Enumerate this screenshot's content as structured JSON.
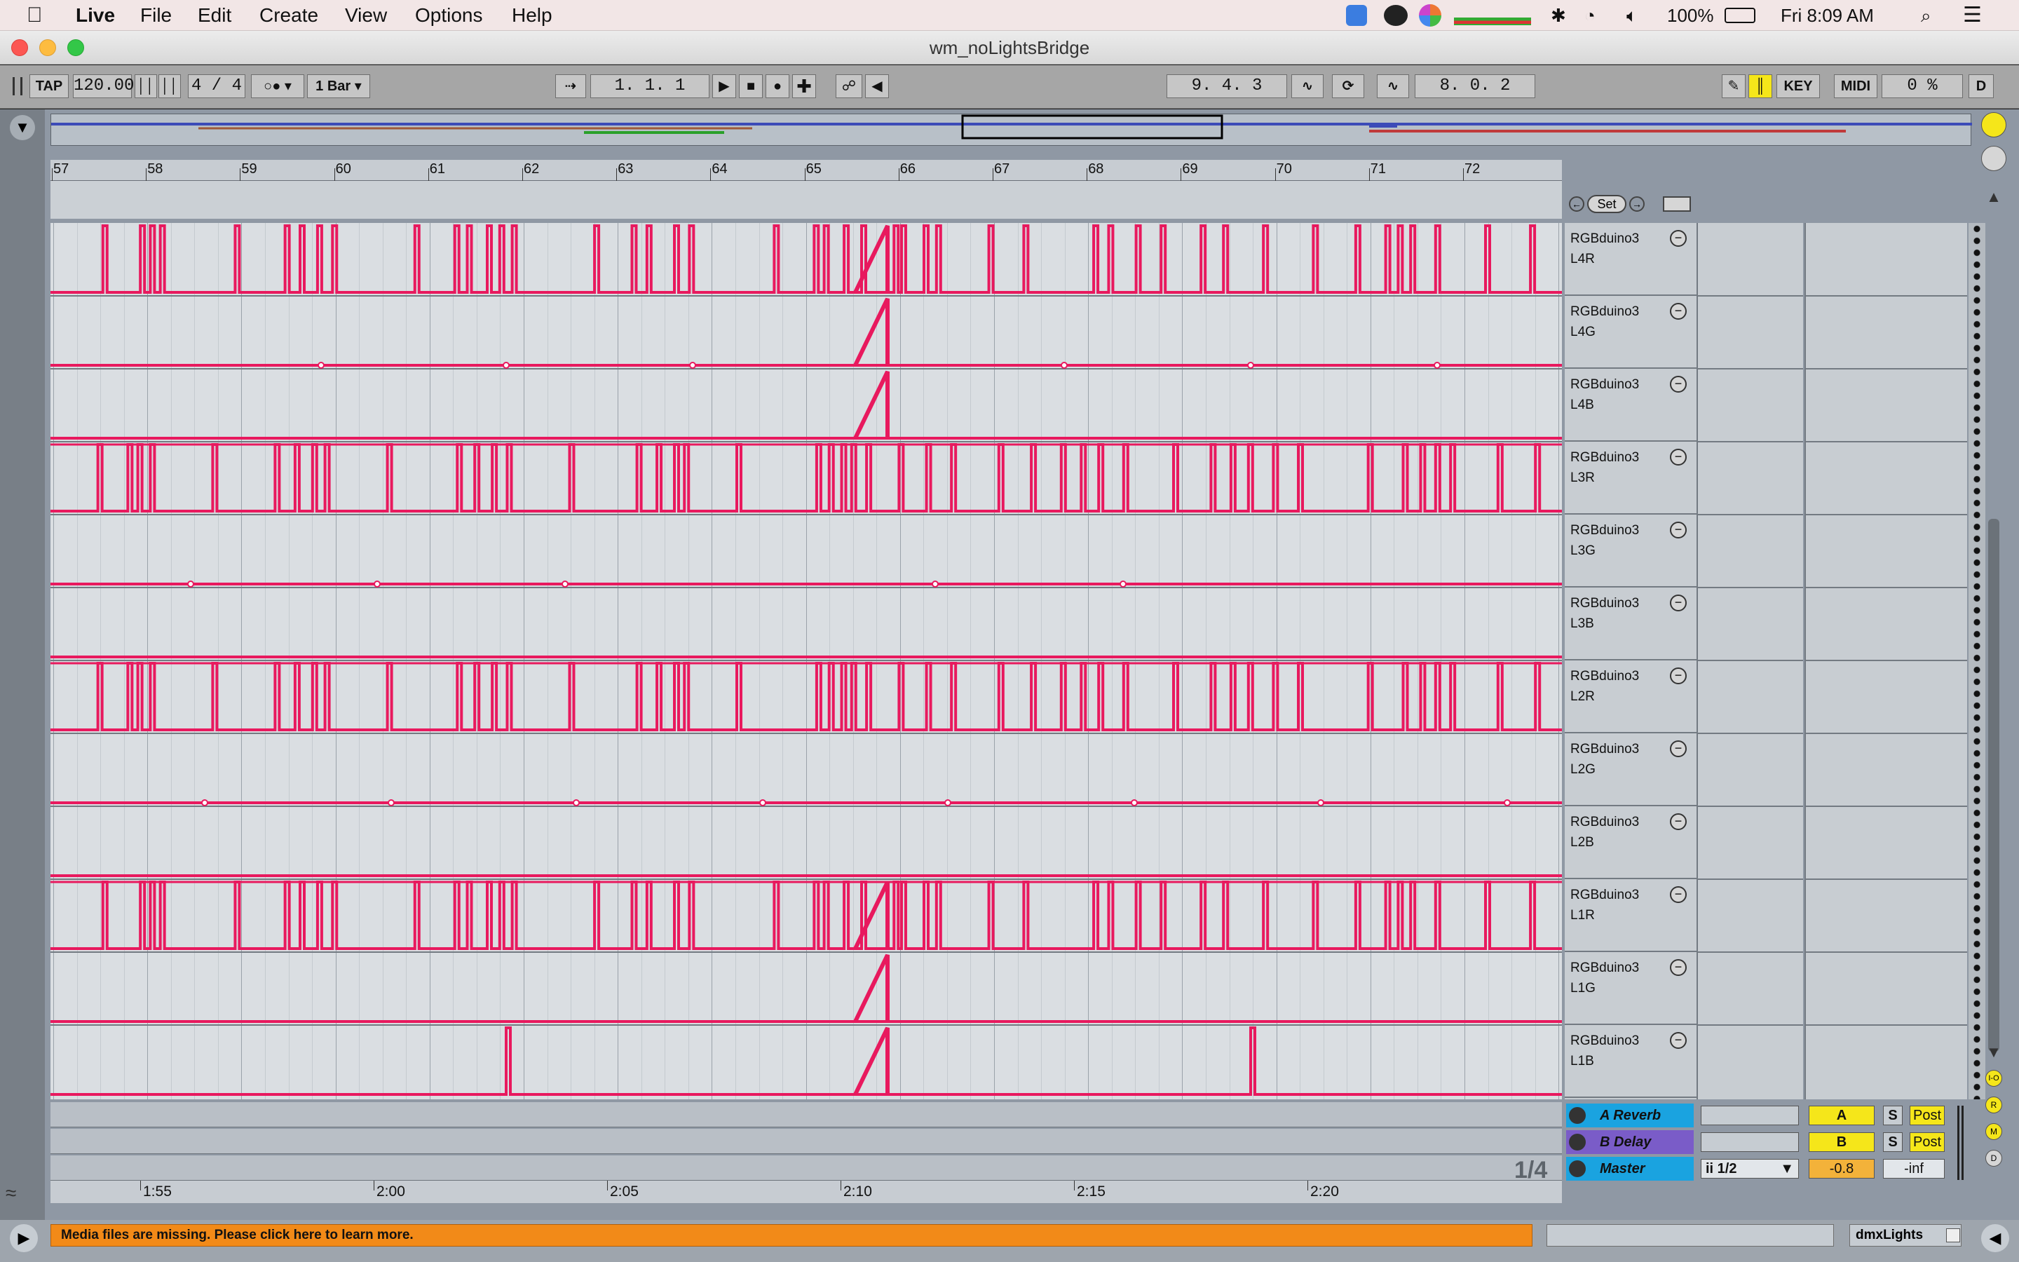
{
  "menubar": {
    "app": "Live",
    "items": [
      "File",
      "Edit",
      "Create",
      "View",
      "Options",
      "Help"
    ],
    "battery": "100%",
    "clock": "Fri 8:09 AM"
  },
  "window": {
    "title": "wm_noLightsBridge"
  },
  "control": {
    "tap": "TAP",
    "tempo": "120.00",
    "signature": "4 / 4",
    "quantize": "1 Bar",
    "position": "1.   1.   1",
    "loop_start": "9.   4.   3",
    "loop_length": "8.   0.   2",
    "key": "KEY",
    "midi": "MIDI",
    "cpu": "0 %",
    "d": "D"
  },
  "ruler": {
    "bars": [
      "57",
      "58",
      "59",
      "60",
      "61",
      "62",
      "63",
      "64",
      "65",
      "66",
      "67",
      "68",
      "69",
      "70",
      "71",
      "72"
    ],
    "set_label": "Set"
  },
  "tracks": [
    {
      "name": "RGBduino3",
      "sub": "L4R"
    },
    {
      "name": "RGBduino3",
      "sub": "L4G"
    },
    {
      "name": "RGBduino3",
      "sub": "L4B"
    },
    {
      "name": "RGBduino3",
      "sub": "L3R"
    },
    {
      "name": "RGBduino3",
      "sub": "L3G"
    },
    {
      "name": "RGBduino3",
      "sub": "L3B"
    },
    {
      "name": "RGBduino3",
      "sub": "L2R"
    },
    {
      "name": "RGBduino3",
      "sub": "L2G"
    },
    {
      "name": "RGBduino3",
      "sub": "L2B"
    },
    {
      "name": "RGBduino3",
      "sub": "L1R"
    },
    {
      "name": "RGBduino3",
      "sub": "L1G"
    },
    {
      "name": "RGBduino3",
      "sub": "L1B"
    }
  ],
  "returns": [
    {
      "name": "A Reverb",
      "send": "A",
      "solo": "S",
      "post": "Post",
      "color": "#1aa3e0"
    },
    {
      "name": "B Delay",
      "send": "B",
      "solo": "S",
      "post": "Post",
      "color": "#7a5cc8"
    },
    {
      "name": "Master",
      "route": "ii 1/2",
      "volume": "-0.8",
      "peak": "-inf",
      "color": "#1aa3e0"
    }
  ],
  "zoom_label": "1/4",
  "time_ruler": [
    "1:55",
    "2:00",
    "2:05",
    "2:10",
    "2:15",
    "2:20"
  ],
  "status": {
    "message": "Media files are missing. Please click here to learn more.",
    "device": "dmxLights"
  },
  "colors": {
    "automation": "#e8195e",
    "status_orange": "#f28a18",
    "highlight_yellow": "#f5e61a"
  },
  "right_dots": [
    "I-O",
    "R",
    "M",
    "D"
  ]
}
